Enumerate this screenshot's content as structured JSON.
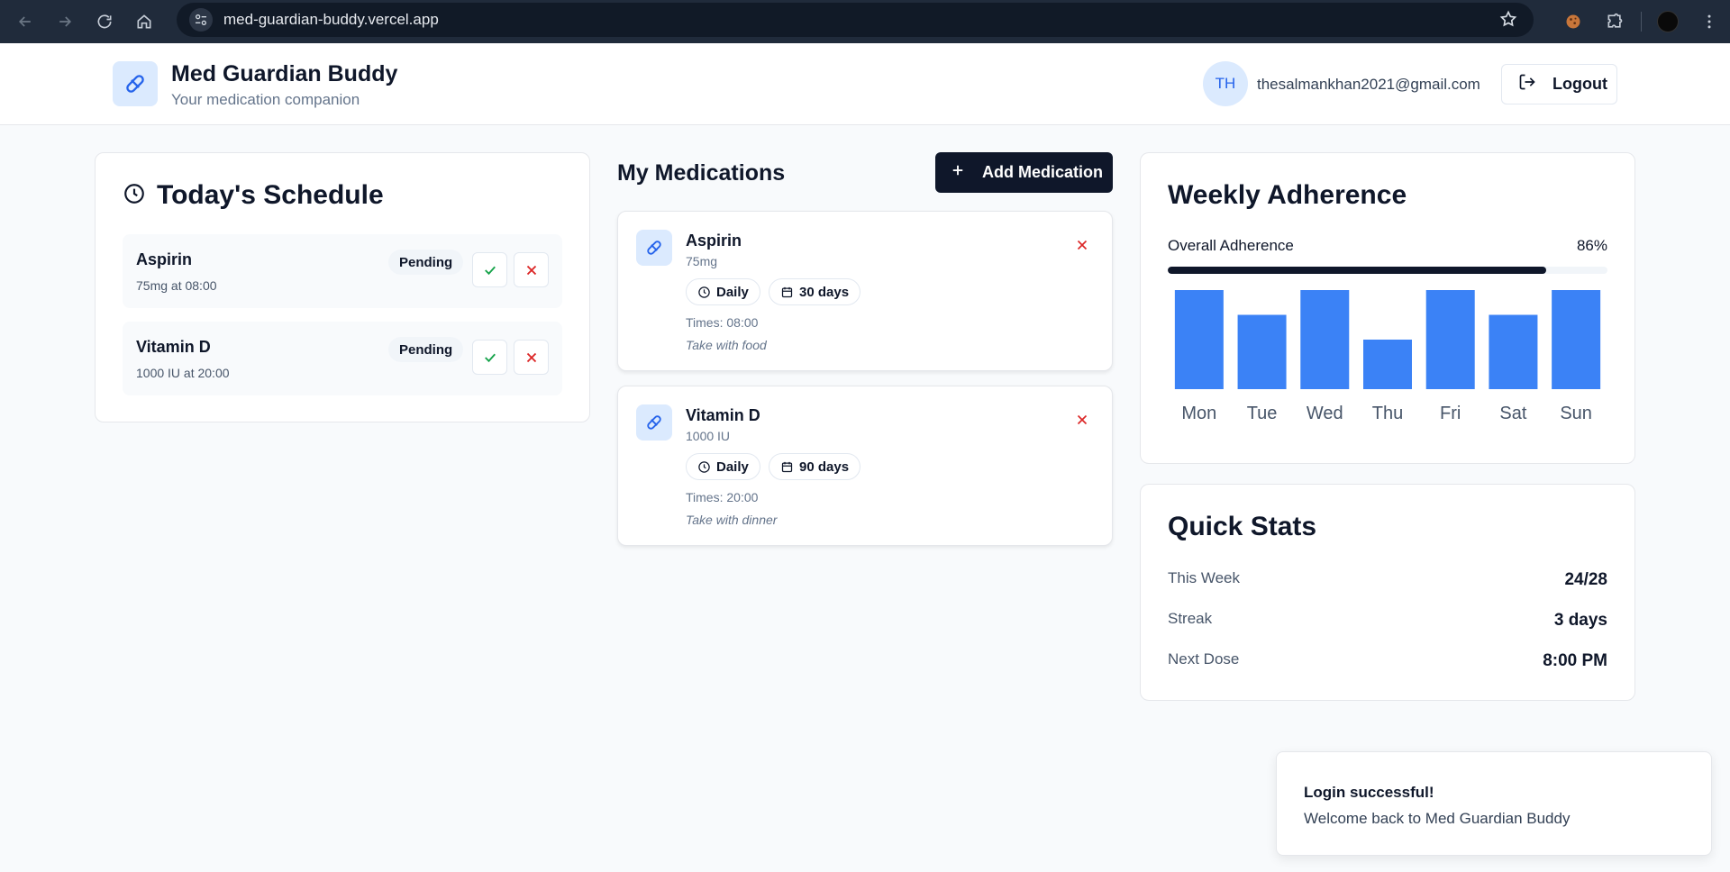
{
  "browser": {
    "url": "med-guardian-buddy.vercel.app"
  },
  "header": {
    "brand_title": "Med Guardian Buddy",
    "brand_subtitle": "Your medication companion",
    "user_initials": "TH",
    "user_email": "thesalmankhan2021@gmail.com",
    "logout_label": "Logout"
  },
  "schedule": {
    "title": "Today's Schedule",
    "items": [
      {
        "name": "Aspirin",
        "detail": "75mg at 08:00",
        "status": "Pending"
      },
      {
        "name": "Vitamin D",
        "detail": "1000 IU at 20:00",
        "status": "Pending"
      }
    ]
  },
  "medications": {
    "title": "My Medications",
    "add_label": "Add Medication",
    "items": [
      {
        "name": "Aspirin",
        "dose": "75mg",
        "frequency": "Daily",
        "duration": "30 days",
        "times": "Times: 08:00",
        "note": "Take with food"
      },
      {
        "name": "Vitamin D",
        "dose": "1000 IU",
        "frequency": "Daily",
        "duration": "90 days",
        "times": "Times: 20:00",
        "note": "Take with dinner"
      }
    ]
  },
  "adherence": {
    "title": "Weekly Adherence",
    "overall_label": "Overall Adherence",
    "overall_pct": "86%",
    "overall_fraction": 0.86,
    "bar_color": "#3b82f6"
  },
  "chart_data": {
    "type": "bar",
    "categories": [
      "Mon",
      "Tue",
      "Wed",
      "Thu",
      "Fri",
      "Sat",
      "Sun"
    ],
    "values": [
      4,
      3,
      4,
      2,
      4,
      3,
      4
    ],
    "ylim": [
      0,
      4
    ]
  },
  "stats": {
    "title": "Quick Stats",
    "items": [
      {
        "label": "This Week",
        "value": "24/28"
      },
      {
        "label": "Streak",
        "value": "3 days"
      },
      {
        "label": "Next Dose",
        "value": "8:00 PM"
      }
    ]
  },
  "toast": {
    "title": "Login successful!",
    "description": "Welcome back to Med Guardian Buddy"
  }
}
